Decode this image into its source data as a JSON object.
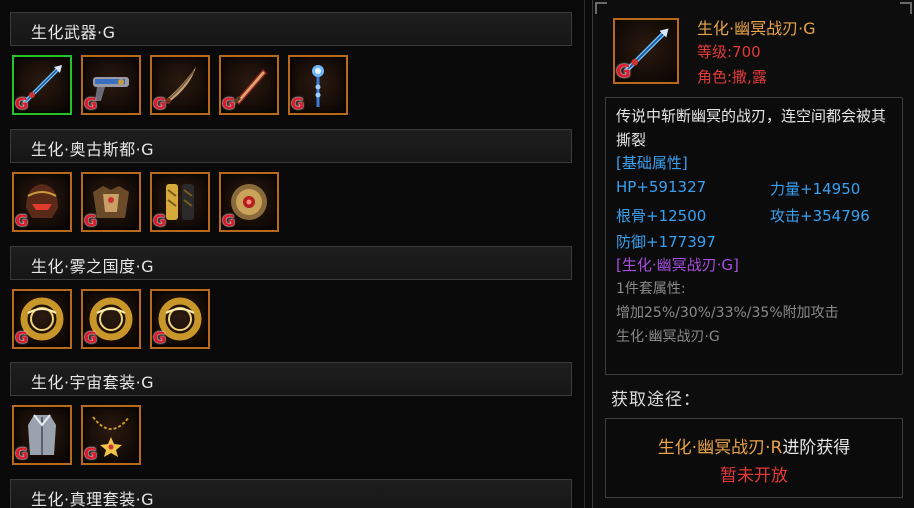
{
  "sections": [
    {
      "title": "生化武器·G",
      "items": [
        {
          "icon": "blue-spear-icon",
          "selected": true
        },
        {
          "icon": "crossbow-icon",
          "selected": false
        },
        {
          "icon": "curved-blade-icon",
          "selected": false
        },
        {
          "icon": "red-greatsword-icon",
          "selected": false
        },
        {
          "icon": "crystal-staff-icon",
          "selected": false
        }
      ]
    },
    {
      "title": "生化·奥古斯都·G",
      "items": [
        {
          "icon": "red-helmet-icon"
        },
        {
          "icon": "chest-armor-icon"
        },
        {
          "icon": "leg-armor-icon"
        },
        {
          "icon": "sun-medallion-icon"
        }
      ]
    },
    {
      "title": "生化·雾之国度·G",
      "items": [
        {
          "icon": "gold-ring-icon"
        },
        {
          "icon": "gold-ring-icon"
        },
        {
          "icon": "gold-ring-icon"
        }
      ]
    },
    {
      "title": "生化·宇宙套装·G",
      "items": [
        {
          "icon": "coat-icon"
        },
        {
          "icon": "star-necklace-icon"
        }
      ]
    },
    {
      "title": "生化·真理套装·G",
      "items": []
    }
  ],
  "badge": "G",
  "detail": {
    "name": "生化·幽冥战刃·G",
    "level": "等级:700",
    "role": "角色:撒,露",
    "description": "传说中斩断幽冥的战刃，连空间都会被其撕裂",
    "attr_title": "[基础属性]",
    "stats": [
      {
        "label": "HP+591327"
      },
      {
        "label": "力量+14950"
      },
      {
        "label": "根骨+12500"
      },
      {
        "label": "攻击+354796"
      },
      {
        "label": "防御+177397"
      }
    ],
    "set_name": "[生化·幽冥战刃·G]",
    "set_lines": [
      "1件套属性:",
      "增加25%/30%/33%/35%附加攻击",
      "生化·幽冥战刃·G"
    ]
  },
  "acquire": {
    "label": "获取途径：",
    "source_item": "生化·幽冥战刃·R",
    "source_suffix": "进阶获得",
    "status": "暂未开放"
  },
  "colors": {
    "gold": "#e8a24a",
    "red": "#e23a3a",
    "blue": "#3aa0f0",
    "purple": "#a54ee0",
    "slot_border": "#b8691b",
    "selected_border": "#27c227"
  }
}
